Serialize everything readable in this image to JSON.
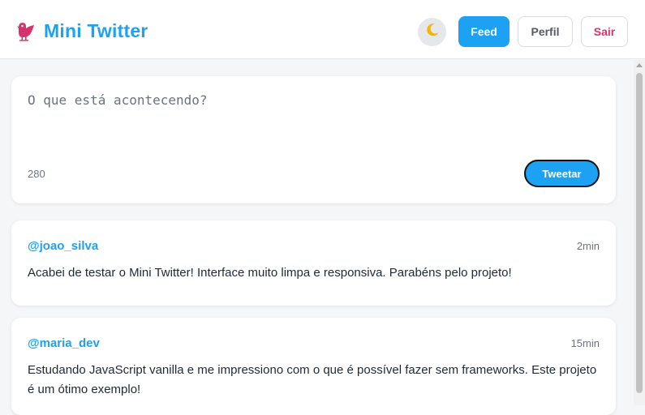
{
  "header": {
    "title": "Mini Twitter",
    "logo_icon": "bird-icon",
    "theme_icon": "moon-icon",
    "nav": {
      "feed": "Feed",
      "perfil": "Perfil",
      "sair": "Sair"
    }
  },
  "compose": {
    "placeholder": "O que está acontecendo?",
    "value": "",
    "char_count": "280",
    "button": "Tweetar"
  },
  "tweets": [
    {
      "user": "@joao_silva",
      "time": "2min",
      "text": "Acabei de testar o Mini Twitter! Interface muito limpa e responsiva. Parabéns pelo projeto!"
    },
    {
      "user": "@maria_dev",
      "time": "15min",
      "text": "Estudando JavaScript vanilla e me impressiono com o que é possível fazer sem frameworks. Este projeto é um ótimo exemplo!"
    }
  ],
  "colors": {
    "accent": "#1da1f2",
    "danger": "#d6336c",
    "logo": "#d6336c"
  }
}
